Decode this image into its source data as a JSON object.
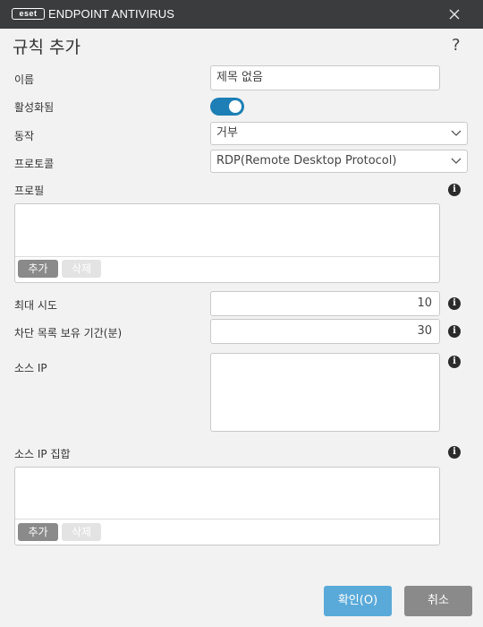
{
  "window": {
    "brand": "eset",
    "product": "ENDPOINT ANTIVIRUS",
    "close_icon": "close-icon"
  },
  "dialog": {
    "title": "규칙 추가",
    "help": "?"
  },
  "form": {
    "name": {
      "label": "이름",
      "value": "제목 없음"
    },
    "enabled": {
      "label": "활성화됨",
      "on": true
    },
    "action": {
      "label": "동작",
      "value": "거부"
    },
    "protocol": {
      "label": "프로토콜",
      "value": "RDP(Remote Desktop Protocol)"
    },
    "profiles": {
      "label": "프로필",
      "add": "추가",
      "delete": "삭제"
    },
    "max_attempts": {
      "label": "최대 시도",
      "value": "10"
    },
    "blacklist_retention": {
      "label": "차단 목록 보유 기간(분)",
      "value": "30"
    },
    "source_ip": {
      "label": "소스 IP"
    },
    "source_ip_sets": {
      "label": "소스 IP 집합",
      "add": "추가",
      "delete": "삭제"
    }
  },
  "footer": {
    "ok": "확인(O)",
    "cancel": "취소"
  },
  "colors": {
    "titlebar": "#3b3c3e",
    "toggle_on": "#1d7fb5",
    "primary_button": "#5aaad9",
    "secondary_button": "#8a8a8a"
  }
}
